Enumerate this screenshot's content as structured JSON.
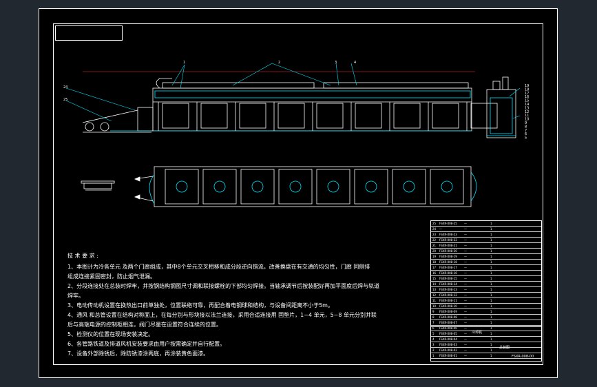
{
  "notes": {
    "heading": "技 术 要 求 :",
    "lines": [
      "1、本图计为冷各单元 及两个门廊组成，其中8个单元交叉相移和成分段逆向错流，改善换盘在有交通的均匀性，门廊 同侧排",
      "组成连接紧固密封，防止烟气泄漏。",
      "2、分段连接处在总装时焊牢，并按钢结构钢图尺寸调和联接螺栓的下部均匀焊接。当轴承调节后按装配好再加平面度后焊与轨道",
      "焊牢。",
      "3、电动传动机设置在换热出口前单独处，位置联络可靠，再配合着电钢球和结构，与设备间距离不小于5m。",
      "4、通风 和总管设置在结构对称面上，在每分别与形块接以法兰连接，采用合适连接用 固垫片，1~4 单元，5~8 单元分别并联",
      "后与高端电源的控制柜相连，阀门尽量在设置符合连续的位置。",
      "5、检测仪的位置在现场安装决定。",
      "6、各管路铁道及排道风机安装要求由用户按需确定并自行配置。",
      "7、设备外部除锈后，除防锈漆涂两底，再涂装黄色面漆。"
    ]
  },
  "parts_table": {
    "rows": [
      {
        "no": "25",
        "code": "FSXR-008-25",
        "name": "—",
        "qty": "1"
      },
      {
        "no": "24",
        "code": "—",
        "name": "—",
        "qty": "1"
      },
      {
        "no": "23",
        "code": "FSXR-008-23",
        "name": "—",
        "qty": "1"
      },
      {
        "no": "22",
        "code": "FSXR-008-22",
        "name": "—",
        "qty": "1"
      },
      {
        "no": "21",
        "code": "FSXR-008-21",
        "name": "—",
        "qty": "1"
      },
      {
        "no": "20",
        "code": "FSXR-008-20",
        "name": "—",
        "qty": "1"
      },
      {
        "no": "19",
        "code": "FSXR-008-19",
        "name": "—",
        "qty": "1"
      },
      {
        "no": "18",
        "code": "FSXR-008-18",
        "name": "—",
        "qty": "1"
      },
      {
        "no": "17",
        "code": "FSXR-008-17",
        "name": "—",
        "qty": "1"
      },
      {
        "no": "16",
        "code": "FSXR-008-16",
        "name": "—",
        "qty": "1"
      },
      {
        "no": "15",
        "code": "FSXR-008-15",
        "name": "—",
        "qty": "1"
      },
      {
        "no": "14",
        "code": "FSXR-008-14",
        "name": "—",
        "qty": "1"
      },
      {
        "no": "13",
        "code": "FSXR-008-13",
        "name": "—",
        "qty": "1"
      },
      {
        "no": "12",
        "code": "FSXR-008-12",
        "name": "—",
        "qty": "1"
      },
      {
        "no": "11",
        "code": "FSXR-008-11",
        "name": "—",
        "qty": "1"
      },
      {
        "no": "10",
        "code": "FSXR-008-10",
        "name": "—",
        "qty": "1"
      },
      {
        "no": "9",
        "code": "FSXR-008-09",
        "name": "—",
        "qty": "1"
      },
      {
        "no": "8",
        "code": "FSXR-008-08",
        "name": "—",
        "qty": "1"
      },
      {
        "no": "7",
        "code": "FSXR-008-07",
        "name": "—",
        "qty": "1"
      },
      {
        "no": "6",
        "code": "FSXR-008-06",
        "name": "—",
        "qty": "1"
      },
      {
        "no": "5",
        "code": "FSXR-008-05",
        "name": "—",
        "qty": "1"
      },
      {
        "no": "4",
        "code": "FSXR-008-04",
        "name": "—",
        "qty": "1"
      },
      {
        "no": "3",
        "code": "FSXR-008-03",
        "name": "—",
        "qty": "1"
      },
      {
        "no": "2",
        "code": "FSXR-008-02",
        "name": "—",
        "qty": "1"
      },
      {
        "no": "1",
        "code": "FSXR-008-01",
        "name": "—",
        "qty": "1"
      }
    ]
  },
  "title_block": {
    "drawing_name": "冷却机",
    "drawing_no": "FSXR-008-00",
    "sheet_label": "总装图"
  },
  "callouts": {
    "top": [
      "1",
      "2",
      "3",
      "4"
    ],
    "side_left": [
      "24",
      "25"
    ],
    "side_right": [
      "19",
      "18",
      "17",
      "16",
      "15",
      "14",
      "13",
      "12",
      "11",
      "10",
      "9",
      "8",
      "7",
      "6",
      "5"
    ]
  },
  "colors": {
    "line": "#ffffff",
    "accent": "#00e5ff",
    "dim": "#ff3333",
    "body": "#000000",
    "outer": "#212830"
  }
}
